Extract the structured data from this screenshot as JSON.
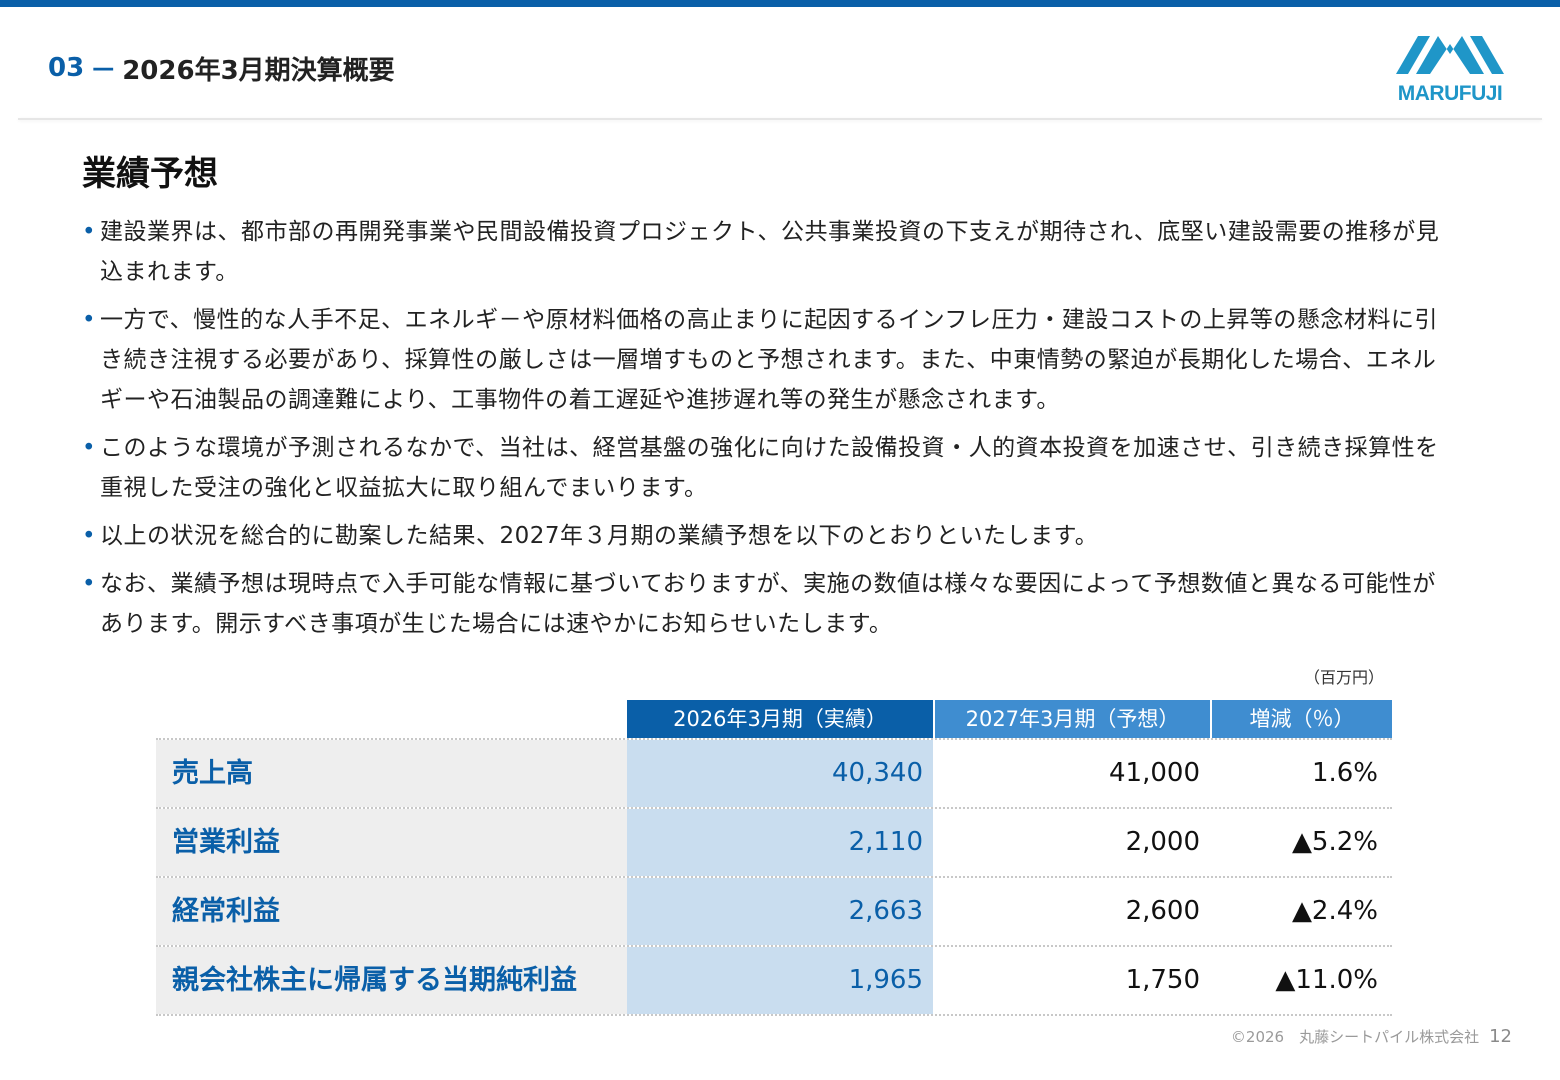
{
  "header": {
    "section_number": "03",
    "section_dash": "－",
    "section_title": "2026年3月期決算概要"
  },
  "logo": {
    "text": "MARUFUJI",
    "icon": "mountain-logo-icon",
    "color": "#1f96c8"
  },
  "heading": "業績予想",
  "bullets": [
    "建設業界は、都市部の再開発事業や民間設備投資プロジェクト、公共事業投資の下支えが期待され、底堅い建設需要の推移が見込まれます。",
    "一方で、慢性的な人手不足、エネルギ－や原材料価格の高止まりに起因するインフレ圧力・建設コストの上昇等の懸念材料に引き続き注視する必要があり、採算性の厳しさは一層増すものと予想されます。また、中東情勢の緊迫が長期化した場合、エネルギーや石油製品の調達難により、工事物件の着工遅延や進捗遅れ等の発生が懸念されます。",
    "このような環境が予測されるなかで、当社は、経営基盤の強化に向けた設備投資・人的資本投資を加速させ、引き続き採算性を重視した受注の強化と収益拡大に取り組んでまいります。",
    "以上の状況を総合的に勘案した結果、2027年３月期の業績予想を以下のとおりといたします。",
    "なお、業績予想は現時点で入手可能な情報に基づいておりますが、実施の数値は様々な要因によって予想数値と異なる可能性があります。開示すべき事項が生じた場合には速やかにお知らせいたします。"
  ],
  "table": {
    "unit": "（百万円）",
    "headers": [
      "2026年3月期（実績）",
      "2027年3月期（予想）",
      "増減（％）"
    ],
    "rows": [
      {
        "label": "売上高",
        "actual": "40,340",
        "forecast": "41,000",
        "change": "1.6%"
      },
      {
        "label": "営業利益",
        "actual": "2,110",
        "forecast": "2,000",
        "change": "▲5.2%"
      },
      {
        "label": "経常利益",
        "actual": "2,663",
        "forecast": "2,600",
        "change": "▲2.4%"
      },
      {
        "label": "親会社株主に帰属する当期純利益",
        "actual": "1,965",
        "forecast": "1,750",
        "change": "▲11.0%"
      }
    ]
  },
  "footer": {
    "copyright": "©2026　丸藤シートパイル株式会社",
    "page": "12"
  },
  "colors": {
    "accent": "#0a5fa8",
    "header_light": "#3f8dd0",
    "actual_bg": "#c9ddef",
    "label_bg": "#eeeeee"
  }
}
